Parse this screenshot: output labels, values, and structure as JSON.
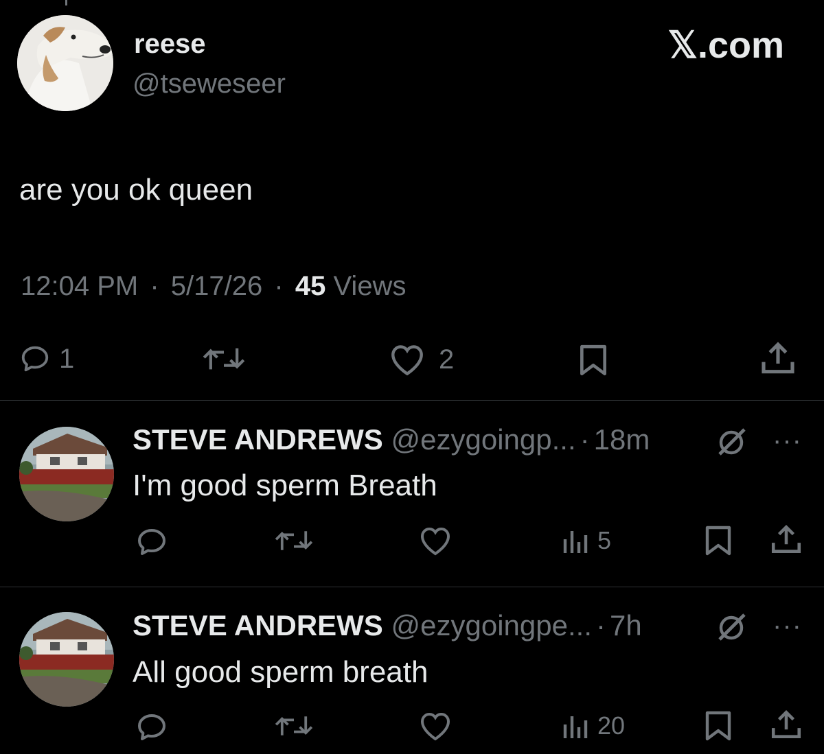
{
  "tweet": {
    "author_name": "reese",
    "author_handle": "@tseweseer",
    "brand": "𝕏.com",
    "text": "are you ok queen",
    "time": "12:04 PM",
    "date": "5/17/26",
    "views_count": "45",
    "views_label": "Views",
    "separator": "·",
    "reply_count": "1",
    "like_count": "2",
    "icons": [
      "reply-icon",
      "retweet-icon",
      "like-icon",
      "bookmark-icon",
      "share-icon"
    ]
  },
  "replies": [
    {
      "name": "STEVE ANDREWS",
      "handle": "@ezygoingp...",
      "time": "18m",
      "text": "I'm good sperm Breath",
      "views": "5",
      "more": "···"
    },
    {
      "name": "STEVE ANDREWS",
      "handle": "@ezygoingpe...",
      "time": "7h",
      "text": "All good sperm breath",
      "views": "20",
      "more": "···"
    }
  ],
  "colors": {
    "background": "#000000",
    "primary_text": "#e7e9ea",
    "secondary_text": "#71767b",
    "divider": "#2f3336"
  }
}
